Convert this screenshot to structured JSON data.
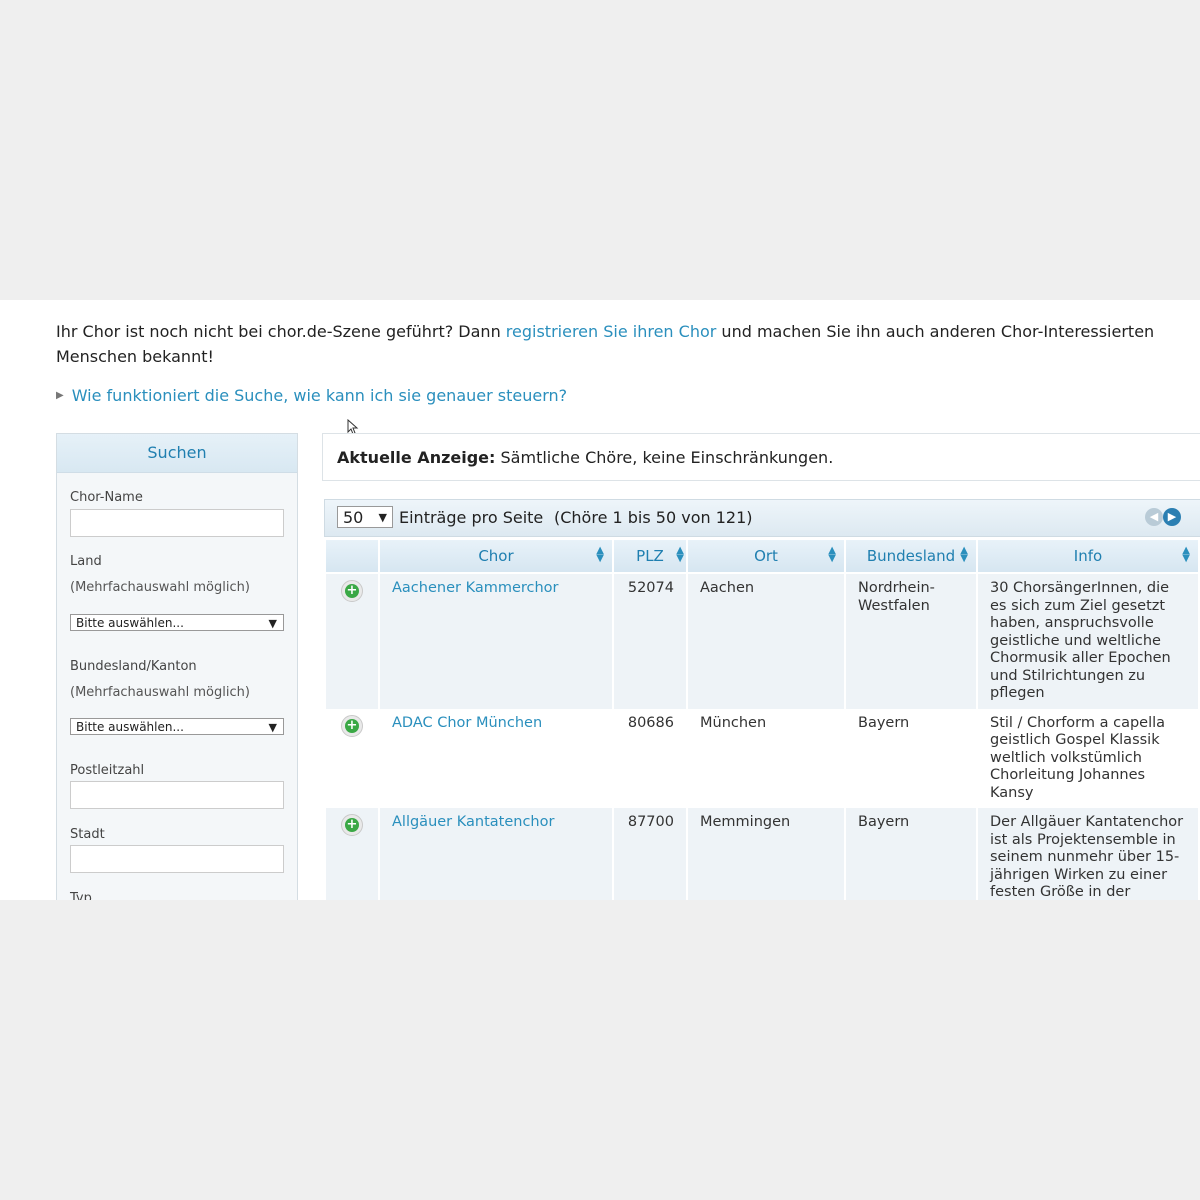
{
  "intro": {
    "text_before": "Ihr Chor ist noch nicht bei chor.de-Szene geführt? Dann ",
    "link": "registrieren Sie ihren Chor",
    "text_after": " und machen Sie ihn auch anderen Chor-Interessierten Menschen bekannt!"
  },
  "howto": {
    "label": "Wie funktioniert die Suche, wie kann ich sie genauer steuern?"
  },
  "search": {
    "title": "Suchen",
    "chor_name_label": "Chor-Name",
    "land_label": "Land",
    "land_hint": "(Mehrfachauswahl möglich)",
    "land_select": "Bitte auswählen...",
    "bundesland_label": "Bundesland/Kanton",
    "bundesland_hint": "(Mehrfachauswahl möglich)",
    "bundesland_select": "Bitte auswählen...",
    "plz_label": "Postleitzahl",
    "stadt_label": "Stadt",
    "typ_label": "Typ"
  },
  "current": {
    "label": "Aktuelle Anzeige:",
    "value": " Sämtliche Chöre, keine Einschränkungen."
  },
  "toolbar": {
    "per_page": "50",
    "per_page_label": "Einträge pro Seite",
    "range": "(Chöre 1 bis 50 von 121)"
  },
  "table": {
    "headers": [
      "",
      "Chor",
      "PLZ",
      "Ort",
      "Bundesland",
      "Info"
    ],
    "rows": [
      {
        "name": "Aachener Kammerchor",
        "plz": "52074",
        "ort": "Aachen",
        "bundesland": "Nordrhein-Westfalen",
        "info": "30 ChorsängerInnen, die es sich zum Ziel gesetzt haben, anspruchsvolle geistliche und weltliche Chormusik aller Epochen und Stilrichtungen zu pflegen"
      },
      {
        "name": "ADAC Chor München",
        "plz": "80686",
        "ort": "München",
        "bundesland": "Bayern",
        "info": "Stil / Chorform a capella geistlich Gospel Klassik weltlich volkstümlich Chorleitung Johannes Kansy"
      },
      {
        "name": "Allgäuer Kantatenchor",
        "plz": "87700",
        "ort": "Memmingen",
        "bundesland": "Bayern",
        "info": "Der Allgäuer Kantatenchor ist als Projektensemble in seinem nunmehr über 15-jährigen Wirken zu einer festen Größe in der Interpretation der Werke"
      }
    ]
  },
  "colors": {
    "link": "#2a8fbd",
    "add_green": "#3aa845"
  }
}
